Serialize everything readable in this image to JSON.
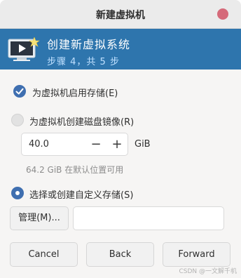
{
  "window": {
    "title": "新建虚拟机"
  },
  "header": {
    "title": "创建新虚拟系统",
    "step": "步骤 4，共 5 步"
  },
  "storage": {
    "enable_label": "为虚拟机启用存储(E)",
    "enable_checked": true,
    "create_disk_label": "为虚拟机创建磁盘镜像(R)",
    "create_disk_checked": false,
    "size_value": "40.0",
    "size_unit": "GiB",
    "available_hint": "64.2 GiB 在默认位置可用",
    "custom_label": "选择或创建自定义存储(S)",
    "custom_checked": true,
    "manage_label": "管理(M)...",
    "path_value": ""
  },
  "spin": {
    "minus": "−",
    "plus": "+"
  },
  "footer": {
    "cancel_label": "Cancel",
    "back_label": "Back",
    "forward_label": "Forward"
  },
  "watermark": "CSDN @一文解千机",
  "colors": {
    "header_bg": "#2e75ad",
    "accent": "#3f6fb0",
    "close": "#d56a7a"
  },
  "icons": {
    "header": "monitor-play-icon",
    "close": "close-icon"
  }
}
